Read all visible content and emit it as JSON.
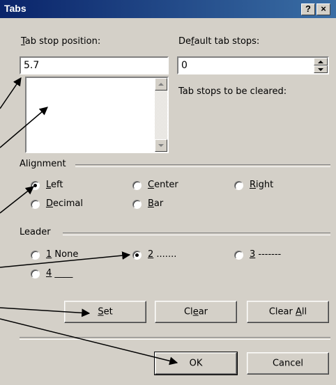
{
  "window": {
    "title": "Tabs",
    "help_btn": "?",
    "close_btn": "×"
  },
  "tab_stop_position": {
    "label": "Tab stop position:",
    "mnemonic": "T",
    "value": "5.7"
  },
  "default_tab_stops": {
    "label": "Default tab stops:",
    "mnemonic": "f",
    "value": "0"
  },
  "tab_stops_to_clear": {
    "label": "Tab stops to be cleared:"
  },
  "alignment": {
    "label": "Alignment",
    "options": [
      {
        "label": "Left",
        "mnemonic": "L",
        "selected": true
      },
      {
        "label": "Center",
        "mnemonic": "C",
        "selected": false
      },
      {
        "label": "Right",
        "mnemonic": "R",
        "selected": false
      },
      {
        "label": "Decimal",
        "mnemonic": "D",
        "selected": false
      },
      {
        "label": "Bar",
        "mnemonic": "B",
        "selected": false
      }
    ]
  },
  "leader": {
    "label": "Leader",
    "options": [
      {
        "label": "1 None",
        "mnemonic": "1",
        "selected": false
      },
      {
        "label": "2 .......",
        "mnemonic": "2",
        "selected": true
      },
      {
        "label": "3 -------",
        "mnemonic": "3",
        "selected": false
      },
      {
        "label": "4 ____",
        "mnemonic": "4",
        "selected": false
      }
    ]
  },
  "buttons": {
    "set": "Set",
    "clear": "Clear",
    "clear_all": "Clear All",
    "ok": "OK",
    "cancel": "Cancel"
  },
  "colors": {
    "titlebar_start": "#0a246a",
    "titlebar_end": "#3a6ea5",
    "dialog_face": "#d4d0c8"
  }
}
